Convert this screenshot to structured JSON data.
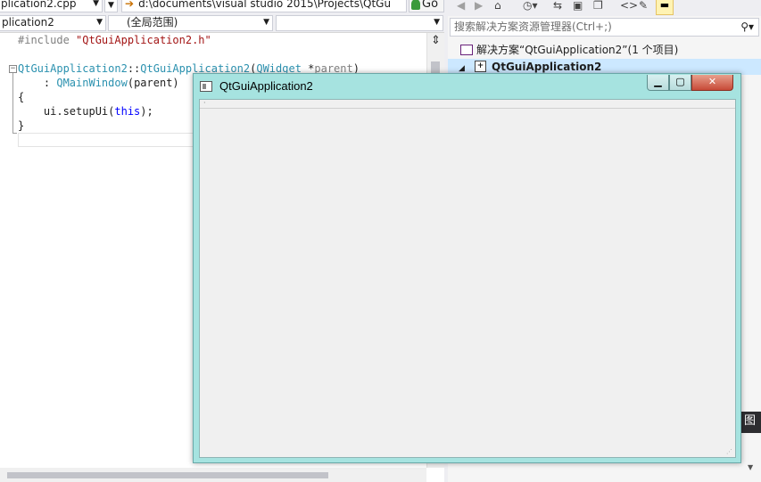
{
  "editor": {
    "file_tab": "plication2.cpp",
    "path": "d:\\documents\\visual studio 2015\\Projects\\QtGu",
    "go_label": "Go",
    "nav": {
      "project": "plication2",
      "scope": "(全局范围)",
      "member": ""
    },
    "code": {
      "l1_directive": "#include ",
      "l1_string": "\"QtGuiApplication2.h\"",
      "l2_class": "QtGuiApplication2",
      "l2_sep": "::",
      "l2_ctor": "QtGuiApplication2",
      "l2_open": "(",
      "l2_type": "QWidget",
      "l2_ptr": " *",
      "l2_param": "parent",
      "l2_close": ")",
      "l3_prefix": "    : ",
      "l3_base": "QMainWindow",
      "l3_args": "(parent)",
      "l4": "{",
      "l5_prefix": "    ui.setupUi(",
      "l5_kw": "this",
      "l5_suffix": ");",
      "l6": "}"
    }
  },
  "solution_explorer": {
    "search_placeholder": "搜索解决方案资源管理器(Ctrl+;)",
    "solution_label": "解决方案“QtGuiApplication2”(1 个项目)",
    "project_label": "QtGuiApplication2",
    "bottom_tab_label": "图"
  },
  "qt_window": {
    "title": "QtGuiApplication2"
  }
}
